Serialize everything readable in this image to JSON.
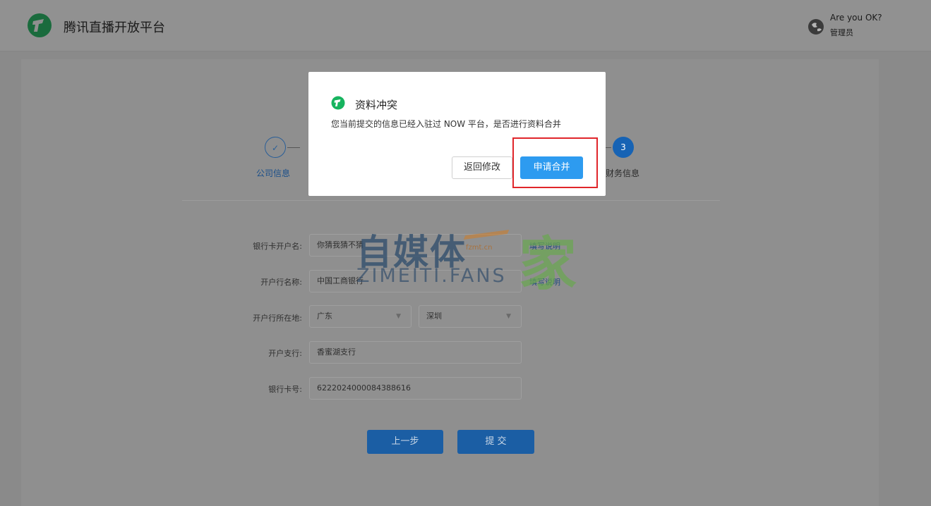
{
  "header": {
    "app_title": "腾讯直播开放平台",
    "user_name": "Are you OK?",
    "user_role": "管理员",
    "icons": {
      "logo": "tencent-now-logo-icon",
      "avatar": "user-avatar-icon"
    }
  },
  "steps": [
    {
      "number": "✓",
      "label": "公司信息",
      "state": "done"
    },
    {
      "number": "3",
      "label": "财务信息",
      "state": "active"
    }
  ],
  "form": {
    "fields": [
      {
        "label": "银行卡开户名:",
        "value": "你猜我猜不猜",
        "help": "填写说明"
      },
      {
        "label": "开户行名称:",
        "value": "中国工商银行",
        "help": "填写说明"
      },
      {
        "label": "开户行所在地:",
        "province": "广东",
        "city": "深圳"
      },
      {
        "label": "开户支行:",
        "value": "香蜜湖支行"
      },
      {
        "label": "银行卡号:",
        "value": "6222024000084388616"
      }
    ],
    "prev_button": "上一步",
    "submit_button": "提 交"
  },
  "watermark": {
    "main": "自媒体",
    "home": "家",
    "sub": "ZIMEITI.FANS",
    "small": "fzmt.cn"
  },
  "modal": {
    "title": "资料冲突",
    "message": "您当前提交的信息已经入驻过 NOW 平台，是否进行资料合并",
    "back_button": "返回修改",
    "merge_button": "申请合并"
  },
  "colors": {
    "accent": "#2d9bf0",
    "highlight": "#e0262b",
    "logo_green": "#17b45f",
    "overlay": "#8a8a8a"
  }
}
